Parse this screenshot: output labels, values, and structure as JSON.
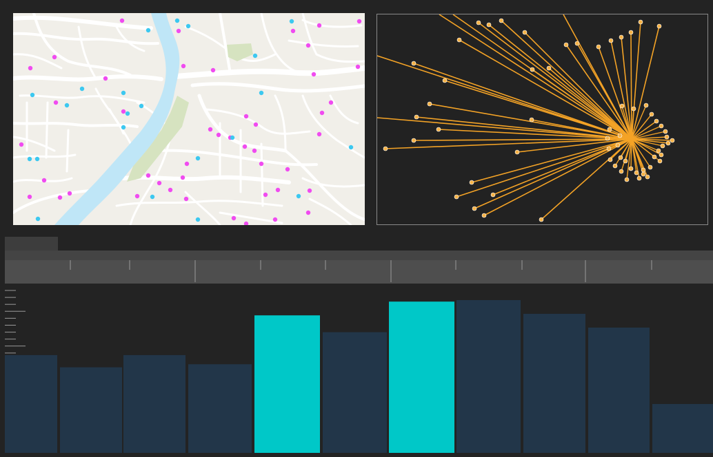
{
  "colors": {
    "background": "#232323",
    "map_land": "#f1efe9",
    "map_road": "#ffffff",
    "map_river": "#bfe6f7",
    "map_park": "#d6e3c0",
    "point_magenta": "#f04bf0",
    "point_cyan": "#3cc8f0",
    "flow_line": "#f4a326",
    "flow_node": "#f7b347",
    "bar_default": "#223649",
    "bar_selected": "#00c8c8",
    "ruler": "#4e4e4e",
    "tab_active": "#3d3d3d"
  },
  "icons": {
    "map_points": "circle-marker",
    "flow_nodes": "circle-node"
  },
  "map": {
    "magenta_point_count": 48,
    "cyan_point_count": 22
  },
  "flow_map": {
    "line_count": 70,
    "hub_count": 1
  },
  "histogram": {
    "bar_count": 11,
    "bar_levels": [
      0.64,
      0.56,
      0.64,
      0.58,
      0.9,
      0.79,
      0.99,
      1.0,
      0.91,
      0.82,
      0.32
    ],
    "selected": [
      false,
      false,
      false,
      false,
      true,
      false,
      true,
      false,
      false,
      false,
      false
    ]
  },
  "ruler": {
    "major_tick_count": 5,
    "minor_tick_count": 6
  }
}
